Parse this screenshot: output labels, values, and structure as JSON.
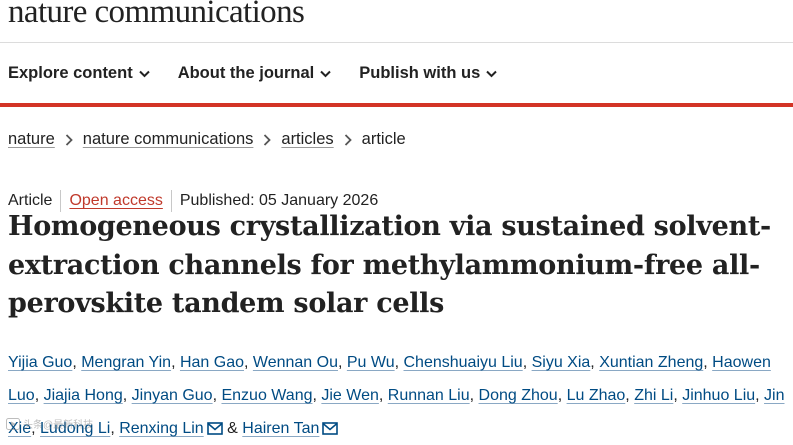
{
  "header": {
    "logo": "nature communications"
  },
  "nav": {
    "items": [
      {
        "label": "Explore content"
      },
      {
        "label": "About the journal"
      },
      {
        "label": "Publish with us"
      }
    ]
  },
  "breadcrumb": {
    "items": [
      "nature",
      "nature communications",
      "articles"
    ],
    "current": "article"
  },
  "article": {
    "type": "Article",
    "access": "Open access",
    "published": "Published: 05 January 2026",
    "title": "Homogeneous crystallization via sustained solvent-extraction channels for methylammonium-free all-perovskite tandem solar cells",
    "conjunction": "&",
    "authors": [
      "Yijia Guo",
      "Mengran Yin",
      "Han Gao",
      "Wennan Ou",
      "Pu Wu",
      "Chenshuaiyu Liu",
      "Siyu Xia",
      "Xuntian Zheng",
      "Haowen Luo",
      "Jiajia Hong",
      "Jinyan Guo",
      "Enzuo Wang",
      "Jie Wen",
      "Runnan Liu",
      "Dong Zhou",
      "Lu Zhao",
      "Zhi Li",
      "Jinhuo Liu",
      "Jin Xie",
      "Ludong Li",
      "Renxing Lin",
      "Hairen Tan"
    ]
  },
  "watermark": {
    "text": "头条@最新科技"
  },
  "colors": {
    "accent": "#d33426",
    "link": "#004b83",
    "open_access": "#c0392b"
  }
}
